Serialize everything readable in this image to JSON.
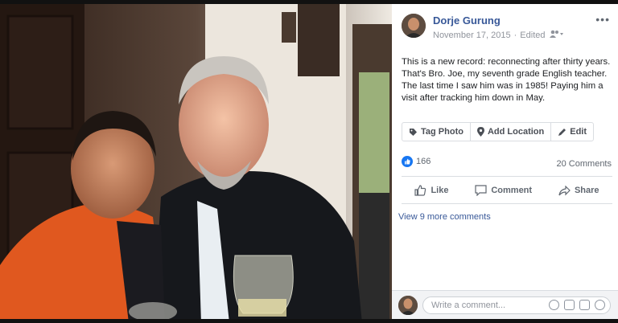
{
  "post": {
    "author": "Dorje Gurung",
    "date": "November 17, 2015",
    "edited": "Edited",
    "text": "This is a new record: reconnecting after thirty years. That's Bro. Joe, my seventh grade English teacher. The last time I saw him was in 1985! Paying him a visit after tracking him down in May."
  },
  "photo_tools": {
    "tag_photo": "Tag Photo",
    "add_location": "Add Location",
    "edit": "Edit"
  },
  "stats": {
    "likes": "166",
    "comments": "20 Comments"
  },
  "actions": {
    "like": "Like",
    "comment": "Comment",
    "share": "Share"
  },
  "view_more": "View 9 more comments",
  "comment_box": {
    "placeholder": "Write a comment..."
  },
  "icons": [
    "more-options-icon",
    "friends-audience-icon",
    "tag-icon",
    "location-pin-icon",
    "pencil-icon",
    "like-reaction-icon",
    "thumbs-up-icon",
    "speech-bubble-icon",
    "share-arrow-icon",
    "emoji-icon",
    "camera-icon",
    "gif-icon",
    "sticker-icon"
  ],
  "colors": {
    "link": "#385898",
    "like_blue": "#1877f2",
    "orange_jacket": "#e0581f"
  }
}
